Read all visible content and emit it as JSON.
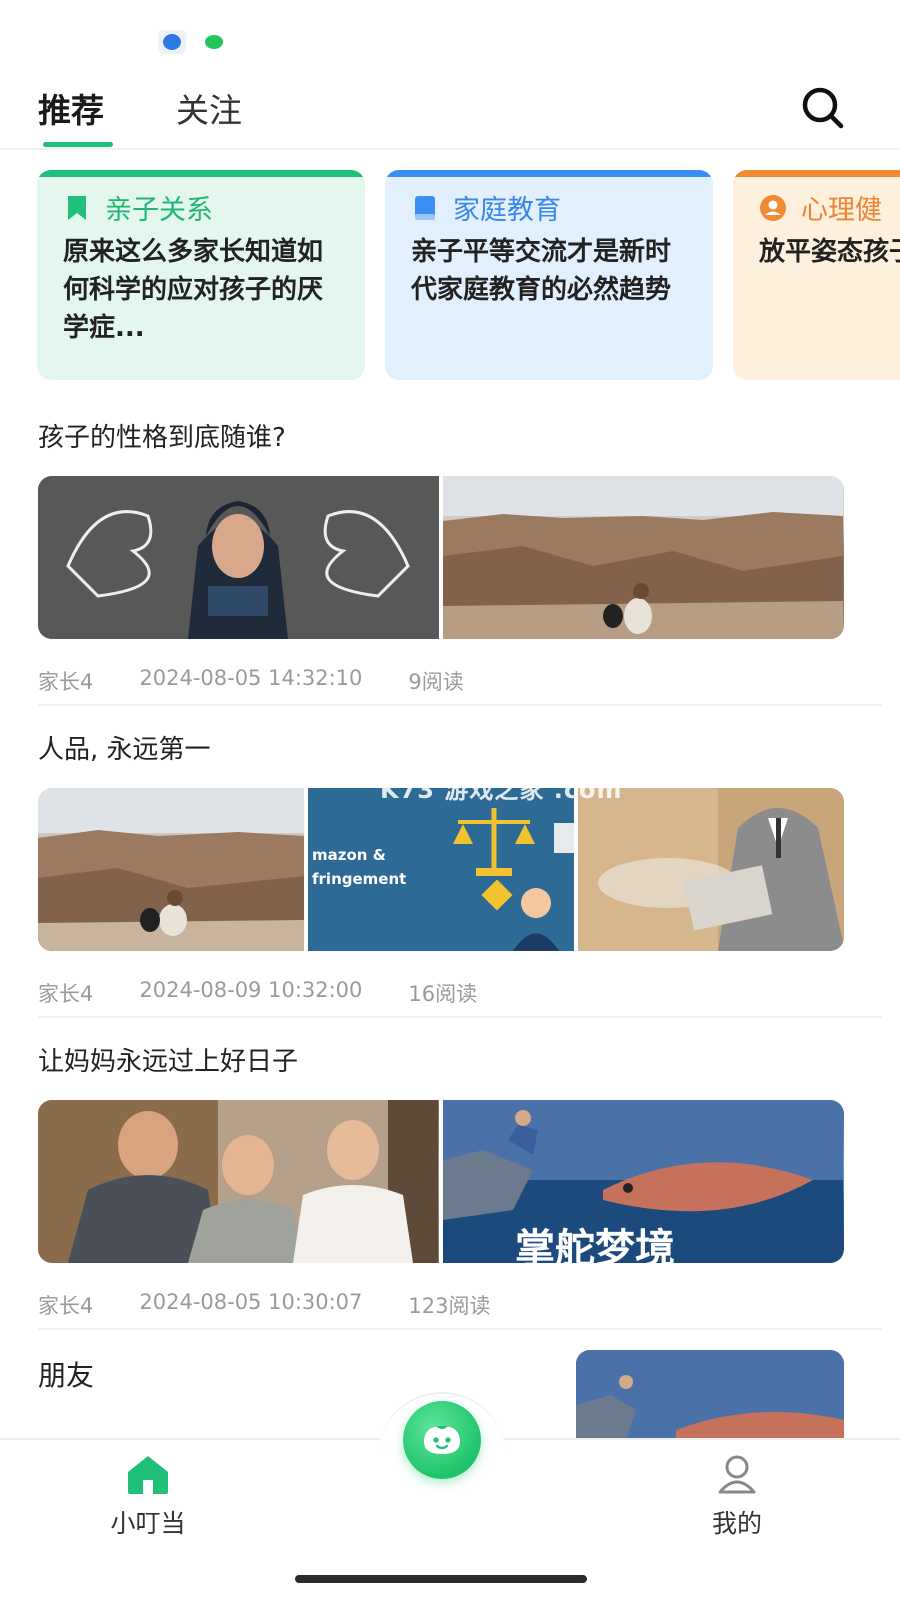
{
  "header": {
    "tabs": [
      {
        "label": "推荐",
        "active": true
      },
      {
        "label": "关注",
        "active": false
      }
    ]
  },
  "topic_cards": [
    {
      "category": "亲子关系",
      "title": "原来这么多家长知道如何科学的应对孩子的厌学症...",
      "icon": "bookmark-icon",
      "color": "#21c07a"
    },
    {
      "category": "家庭教育",
      "title": "亲子平等交流才是新时代家庭教育的必然趋势",
      "icon": "book-icon",
      "color": "#3b8ef2"
    },
    {
      "category": "心理健",
      "title": "放平姿态孩子的发",
      "icon": "user-circle-icon",
      "color": "#f08a34"
    }
  ],
  "posts": [
    {
      "title": "孩子的性格到底随谁?",
      "author": "家长4",
      "time": "2024-08-05 14:32:10",
      "reads": "9阅读"
    },
    {
      "title": "人品, 永远第一",
      "author": "家长4",
      "time": "2024-08-09 10:32:00",
      "reads": "16阅读"
    },
    {
      "title": "让妈妈永远过上好日子",
      "author": "家长4",
      "time": "2024-08-05 10:30:07",
      "reads": "123阅读"
    },
    {
      "title": "朋友"
    }
  ],
  "image_text": {
    "law_caption_1": "mazon &",
    "law_caption_2": "fringement",
    "fish_caption": "掌舵梦境"
  },
  "watermark": "K73 游戏之家 .com",
  "bottom_nav": {
    "home_label": "小叮当",
    "me_label": "我的"
  }
}
